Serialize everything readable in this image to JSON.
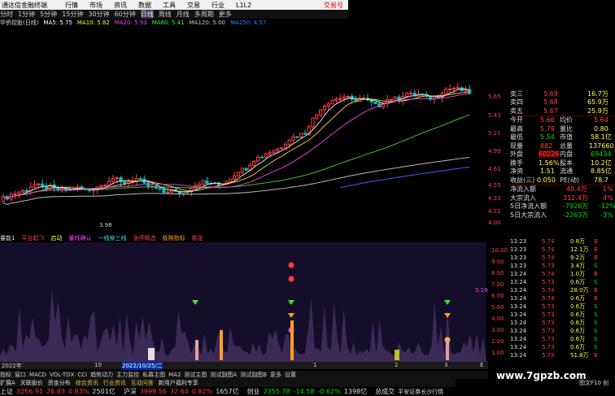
{
  "app": {
    "title": "通达信金融终端",
    "menu": [
      "行情",
      "市场",
      "资讯",
      "数据",
      "工具",
      "交易",
      "行业",
      "L1L2"
    ],
    "alert": "交易号"
  },
  "toolbar": {
    "items": [
      "分时",
      "1分钟",
      "5分钟",
      "15分钟",
      "30分钟",
      "60分钟",
      "日线",
      "周线",
      "月线",
      "多周期",
      "更多"
    ]
  },
  "ma_line": {
    "name": "华侨控股(日线)",
    "items": [
      {
        "label": "MA5: 5.75",
        "color": "#ffffff"
      },
      {
        "label": "MA10: 5.82",
        "color": "#ffff40"
      },
      {
        "label": "MA20: 5.93",
        "color": "#ff40ff"
      },
      {
        "label": "MA60: 5.41",
        "color": "#40ff40"
      },
      {
        "label": "MA120: 5.00",
        "color": "#cccccc"
      },
      {
        "label": "MA250: 4.57",
        "color": "#4080ff"
      }
    ]
  },
  "price_axis": [
    "5.65",
    "5.43",
    "5.21",
    "4.99",
    "4.77",
    "4.55",
    "4.33",
    "4.11",
    "4.00"
  ],
  "current_price": "4.61",
  "low_label": "3.98",
  "quote_panel": {
    "asks": [
      {
        "label": "卖三",
        "price": "5.69",
        "vol": "16.7万"
      },
      {
        "label": "卖四",
        "price": "5.68",
        "vol": "65.9万"
      },
      {
        "label": "卖五",
        "price": "5.67",
        "vol": "25.9万"
      }
    ],
    "rows": [
      {
        "l1": "今开",
        "v1": "5.66",
        "l2": "均价",
        "v2": "5.64"
      },
      {
        "l1": "最高",
        "v1": "5.79",
        "l2": "量比",
        "v2": "0.80"
      },
      {
        "l1": "最低",
        "v1": "5.54",
        "l2": "市值",
        "v2": "58.1亿"
      },
      {
        "l1": "现量",
        "v1": "882",
        "l2": "总量",
        "v2": "137660"
      },
      {
        "l1": "外盘",
        "v1": "60226",
        "l2": "内盘",
        "v2": "69434"
      },
      {
        "l1": "换手",
        "v1": "1.56%",
        "l2": "股本",
        "v2": "10.2亿"
      },
      {
        "l1": "净资",
        "v1": "1.51",
        "l2": "流通",
        "v2": "8.85亿"
      },
      {
        "l1": "收益(三)",
        "v1": "0.050",
        "l2": "PE(动)",
        "v2": "78.7"
      }
    ],
    "flows": [
      {
        "label": "净流入额",
        "value": "49.4万",
        "pct": "1%"
      },
      {
        "label": "大宗流入",
        "value": "312.4万",
        "pct": "4%"
      },
      {
        "label": "5日净流入额",
        "value": "-7926万",
        "pct": "-12%"
      },
      {
        "label": "5日大宗流入",
        "value": "-2263万",
        "pct": "-3%"
      }
    ]
  },
  "ticks": [
    {
      "t": "13:23",
      "p": "5.74",
      "v": "0.8万",
      "s": "B"
    },
    {
      "t": "13:23",
      "p": "5.74",
      "v": "12.1万",
      "s": "B"
    },
    {
      "t": "13:23",
      "p": "5.74",
      "v": "9.2万",
      "s": "B"
    },
    {
      "t": "13:23",
      "p": "5.73",
      "v": "3.4万",
      "s": "S"
    },
    {
      "t": "13:24",
      "p": "5.74",
      "v": "1.0万",
      "s": "B"
    },
    {
      "t": "13:24",
      "p": "5.73",
      "v": "0.6万",
      "s": "S"
    },
    {
      "t": "13:24",
      "p": "5.74",
      "v": "28.0万",
      "s": "B"
    },
    {
      "t": "13:24",
      "p": "5.74",
      "v": "0.6万",
      "s": "B"
    },
    {
      "t": "13:24",
      "p": "5.73",
      "v": "0.6万",
      "s": "S"
    },
    {
      "t": "13:24",
      "p": "5.73",
      "v": "0.6万",
      "s": "S"
    },
    {
      "t": "13:24",
      "p": "5.73",
      "v": "0.6万",
      "s": "S"
    },
    {
      "t": "13:24",
      "p": "5.73",
      "v": "0.6万",
      "s": "S"
    },
    {
      "t": "13:24",
      "p": "5.73",
      "v": "0.6万",
      "s": "S"
    },
    {
      "t": "13:24",
      "p": "5.73",
      "v": "0.6万",
      "s": "S"
    },
    {
      "t": "13:24",
      "p": "5.74",
      "v": "51.8万",
      "s": "B"
    }
  ],
  "indicator": {
    "title": "量能1",
    "items": [
      {
        "label": "平台起飞",
        "color": "#ff4040"
      },
      {
        "label": "启动",
        "color": "#ffff40"
      },
      {
        "label": "量线确认",
        "color": "#ff40ff"
      },
      {
        "label": "一线穿三线",
        "color": "#40e0e0"
      },
      {
        "label": "涨停精选",
        "color": "#ff4040"
      },
      {
        "label": "极限指标",
        "color": "#ffa020"
      },
      {
        "label": "看涨",
        "color": "#ff4040"
      }
    ],
    "axis": [
      "10.00",
      "9.00",
      "8.00",
      "7.00",
      "6.00",
      "5.00",
      "4.00",
      "3.00",
      "2.00",
      "1.00"
    ],
    "marker_value": "5.19"
  },
  "date_bar": {
    "left": "2022年",
    "mark1": "10",
    "highlight": "2022/10/25/二",
    "mark2": "1",
    "mark3": "2",
    "mark4": "3",
    "right": "E"
  },
  "tabs": [
    "指标",
    "窗口",
    "MACD",
    "VOL-TDX",
    "CCI",
    "趋势动力",
    "主力监控",
    "私募主图",
    "MA2",
    "测试主图",
    "测试副图A",
    "测试副图B",
    "更多",
    "设置"
  ],
  "tabs2": [
    "扩展A",
    "关联股价",
    "资金分布",
    "综合资讯",
    "行业资讯",
    "互动问答",
    "新用户福利专享"
  ],
  "status": {
    "idx1_name": "上证",
    "idx1_val": "3256.91",
    "idx1_chg": "26.83",
    "idx1_pct": "0.83%",
    "idx1_amt": "2501亿",
    "idx2_name": "沪深",
    "idx2_val": "3999.56",
    "idx2_chg": "32.64",
    "idx2_pct": "0.82%",
    "idx2_amt": "1657亿",
    "idx3_name": "创业",
    "idx3_val": "2355.78",
    "idx3_chg": "-14.58",
    "idx3_pct": "-0.62%",
    "idx3_amt": "1398亿",
    "broker": "总成交",
    "broker2": "平安证券长沙行情",
    "watermark": "www.7gpzb.com",
    "corner": "图文F10 创"
  }
}
